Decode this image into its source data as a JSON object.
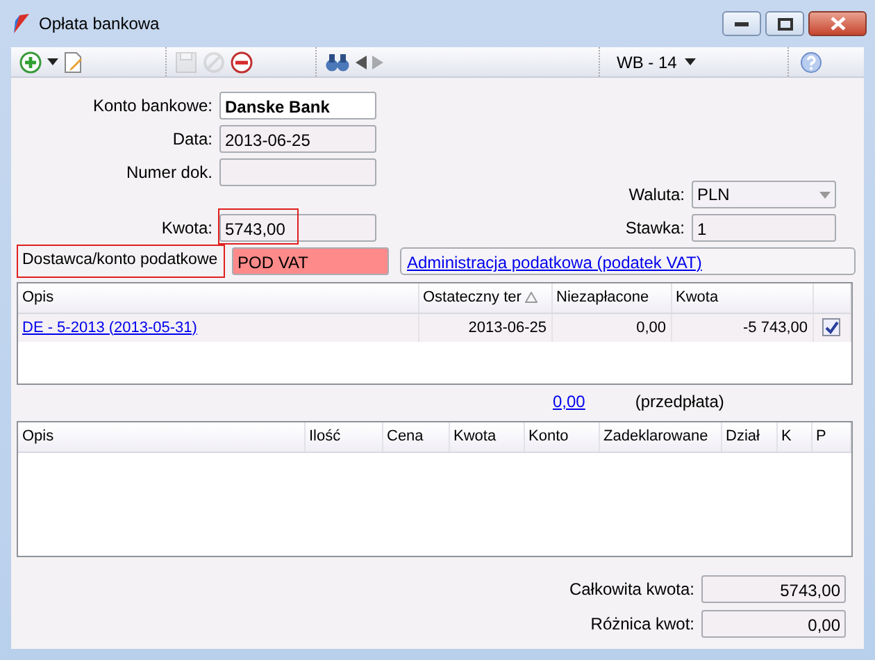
{
  "window": {
    "title": "Opłata bankowa"
  },
  "toolbar": {
    "groups": [
      {
        "items": [
          {
            "kind": "add",
            "disabled": false
          },
          {
            "kind": "caret",
            "disabled": false
          },
          {
            "kind": "edit",
            "disabled": false
          }
        ]
      },
      {
        "items": [
          {
            "kind": "save",
            "disabled": true
          },
          {
            "kind": "cancel",
            "disabled": true
          },
          {
            "kind": "remove",
            "disabled": false
          }
        ]
      },
      {
        "items": [
          {
            "kind": "find",
            "disabled": false
          },
          {
            "kind": "previous",
            "disabled": false
          },
          {
            "kind": "next",
            "disabled": true
          }
        ]
      },
      {
        "items": [
          {
            "kind": "selector",
            "label": "WB - 14",
            "disabled": false
          }
        ]
      },
      {
        "items": [
          {
            "kind": "help",
            "disabled": false
          }
        ]
      }
    ]
  },
  "form": {
    "bank_account": {
      "label": "Konto bankowe:",
      "value": "Danske Bank",
      "read_only": false
    },
    "date": {
      "label": "Data:",
      "value": "2013-06-25",
      "read_only": true
    },
    "document_number": {
      "label": "Numer dok.",
      "read_only": true
    },
    "amount": {
      "label": "Kwota:",
      "value": "5743,00",
      "read_only": true,
      "highlighted": true
    },
    "currency": {
      "label": "Waluta:",
      "value": "PLN"
    },
    "rate": {
      "label": "Stawka:",
      "value": "1"
    },
    "supplier": {
      "label": "Dostawca/konto podatkowe",
      "value": "POD VAT",
      "highlighted": true,
      "invalid": true
    },
    "tax_office_link": "Administracja podatkowa (podatek VAT)"
  },
  "payments_table": {
    "columns": [
      {
        "label": "Opis"
      },
      {
        "label": "Ostateczny ter",
        "sorted_ascending": true
      },
      {
        "label": "Niezapłacone"
      },
      {
        "label": "Kwota"
      }
    ],
    "rows": [
      {
        "description": "DE - 5-2013 (2013-05-31)",
        "due_date": "2013-06-25",
        "unpaid": "0,00",
        "amount": "-5 743,00",
        "checked": true
      }
    ]
  },
  "prepayment": {
    "value": "0,00",
    "label": "(przedpłata)"
  },
  "items_table": {
    "columns": [
      "Opis",
      "Ilość",
      "Cena",
      "Kwota",
      "Konto",
      "Zadeklarowane",
      "Dział",
      "K",
      "P"
    ]
  },
  "totals": [
    {
      "label": "Całkowita kwota:",
      "value": "5743,00"
    },
    {
      "label": "Różnica kwot:",
      "value": "0,00"
    }
  ]
}
